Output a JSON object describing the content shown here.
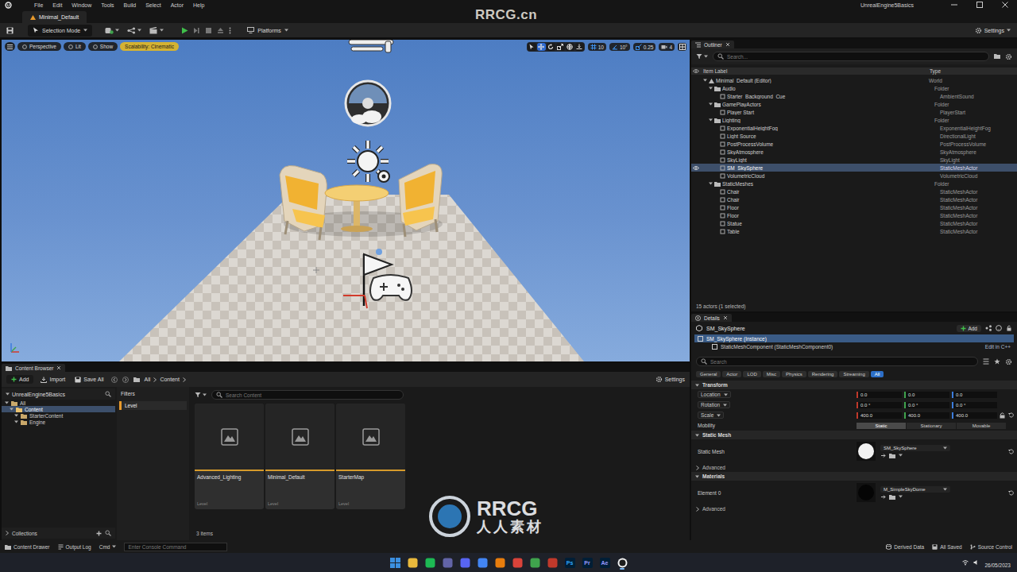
{
  "menu_bar": {
    "items": [
      "File",
      "Edit",
      "Window",
      "Tools",
      "Build",
      "Select",
      "Actor",
      "Help"
    ],
    "project": "UnrealEngine5Basics"
  },
  "level_tab": {
    "label": "Minimal_Default",
    "selected": true
  },
  "toolbar": {
    "mode": "Selection Mode",
    "platforms": "Platforms",
    "settings": "Settings"
  },
  "viewport": {
    "buttons": [
      {
        "label": "Perspective",
        "kind": "plain"
      },
      {
        "label": "Lit",
        "kind": "plain"
      },
      {
        "label": "Show",
        "kind": "plain"
      },
      {
        "label": "Scalability: Cinematic",
        "kind": "warning"
      }
    ],
    "transform_tools": [
      {
        "kind": "select",
        "selected": false
      },
      {
        "kind": "move",
        "selected": true
      },
      {
        "kind": "rotate",
        "selected": false
      },
      {
        "kind": "scale",
        "selected": false
      }
    ],
    "snaps": [
      {
        "kind": "grid",
        "value": "10",
        "on": true
      },
      {
        "kind": "rotate",
        "value": "10°",
        "on": true
      },
      {
        "kind": "scale",
        "value": "0.25",
        "on": true
      },
      {
        "kind": "camera",
        "value": "4",
        "on": false
      }
    ]
  },
  "outliner": {
    "tab": "Outliner",
    "search": "Search...",
    "columns": [
      "Item Label",
      "Type"
    ],
    "rows": [
      {
        "label": "Minimal_Default (Editor)",
        "type": "World",
        "depth": 0,
        "kind": "world",
        "expanded": true,
        "selected": false,
        "eye": false
      },
      {
        "label": "Audio",
        "type": "Folder",
        "depth": 1,
        "kind": "folder",
        "expanded": true,
        "selected": false,
        "eye": false
      },
      {
        "label": "Starter_Background_Cue",
        "type": "AmbientSound",
        "depth": 2,
        "kind": "actor",
        "expanded": false,
        "selected": false,
        "eye": false
      },
      {
        "label": "GamePlayActors",
        "type": "Folder",
        "depth": 1,
        "kind": "folder",
        "expanded": true,
        "selected": false,
        "eye": false
      },
      {
        "label": "Player Start",
        "type": "PlayerStart",
        "depth": 2,
        "kind": "actor",
        "expanded": false,
        "selected": false,
        "eye": false
      },
      {
        "label": "Lighting",
        "type": "Folder",
        "depth": 1,
        "kind": "folder",
        "expanded": true,
        "selected": false,
        "eye": false
      },
      {
        "label": "ExponentialHeightFog",
        "type": "ExponentialHeightFog",
        "depth": 2,
        "kind": "actor",
        "expanded": false,
        "selected": false,
        "eye": false
      },
      {
        "label": "Light Source",
        "type": "DirectionalLight",
        "depth": 2,
        "kind": "actor",
        "expanded": false,
        "selected": false,
        "eye": false
      },
      {
        "label": "PostProcessVolume",
        "type": "PostProcessVolume",
        "depth": 2,
        "kind": "actor",
        "expanded": false,
        "selected": false,
        "eye": false
      },
      {
        "label": "SkyAtmosphere",
        "type": "SkyAtmosphere",
        "depth": 2,
        "kind": "actor",
        "expanded": false,
        "selected": false,
        "eye": false
      },
      {
        "label": "SkyLight",
        "type": "SkyLight",
        "depth": 2,
        "kind": "actor",
        "expanded": false,
        "selected": false,
        "eye": false
      },
      {
        "label": "SM_SkySphere",
        "type": "StaticMeshActor",
        "depth": 2,
        "kind": "actor",
        "expanded": false,
        "selected": true,
        "eye": true
      },
      {
        "label": "VolumetricCloud",
        "type": "VolumetricCloud",
        "depth": 2,
        "kind": "actor",
        "expanded": false,
        "selected": false,
        "eye": false
      },
      {
        "label": "StaticMeshes",
        "type": "Folder",
        "depth": 1,
        "kind": "folder",
        "expanded": true,
        "selected": false,
        "eye": false
      },
      {
        "label": "Chair",
        "type": "StaticMeshActor",
        "depth": 2,
        "kind": "actor",
        "expanded": false,
        "selected": false,
        "eye": false
      },
      {
        "label": "Chair",
        "type": "StaticMeshActor",
        "depth": 2,
        "kind": "actor",
        "expanded": false,
        "selected": false,
        "eye": false
      },
      {
        "label": "Floor",
        "type": "StaticMeshActor",
        "depth": 2,
        "kind": "actor",
        "expanded": false,
        "selected": false,
        "eye": false
      },
      {
        "label": "Floor",
        "type": "StaticMeshActor",
        "depth": 2,
        "kind": "actor",
        "expanded": false,
        "selected": false,
        "eye": false
      },
      {
        "label": "Statue",
        "type": "StaticMeshActor",
        "depth": 2,
        "kind": "actor",
        "expanded": false,
        "selected": false,
        "eye": false
      },
      {
        "label": "Table",
        "type": "StaticMeshActor",
        "depth": 2,
        "kind": "actor",
        "expanded": false,
        "selected": false,
        "eye": false
      }
    ],
    "footer": "15 actors (1 selected)"
  },
  "details": {
    "tab": "Details",
    "title": "SM_SkySphere",
    "add": "Add",
    "components": [
      {
        "label": "SM_SkySphere (Instance)",
        "depth": 0,
        "selected": true,
        "link": ""
      },
      {
        "label": "StaticMeshComponent (StaticMeshComponent0)",
        "depth": 1,
        "selected": false,
        "link": "Edit in C++"
      }
    ],
    "search": "Search",
    "filters": [
      {
        "label": "General",
        "selected": false
      },
      {
        "label": "Actor",
        "selected": false
      },
      {
        "label": "LOD",
        "selected": false
      },
      {
        "label": "Misc",
        "selected": false
      },
      {
        "label": "Physics",
        "selected": false
      },
      {
        "label": "Rendering",
        "selected": false
      },
      {
        "label": "Streaming",
        "selected": false
      },
      {
        "label": "All",
        "selected": true
      }
    ],
    "sections": [
      {
        "title": "Transform",
        "rows": [
          {
            "kind": "vector",
            "label": "Location",
            "values": [
              "0.0",
              "0.0",
              "0.0"
            ],
            "lock_icon": false,
            "resettable": false
          },
          {
            "kind": "vector",
            "label": "Rotation",
            "values": [
              "0.0 °",
              "0.0 °",
              "0.0 °"
            ],
            "lock_icon": false,
            "resettable": false
          },
          {
            "kind": "vector",
            "label": "Scale",
            "values": [
              "400.0",
              "400.0",
              "400.0"
            ],
            "lock_icon": true,
            "resettable": true
          },
          {
            "kind": "mobility",
            "label": "Mobility",
            "options": [
              {
                "label": "Static",
                "selected": true
              },
              {
                "label": "Stationary",
                "selected": false
              },
              {
                "label": "Movable",
                "selected": false
              }
            ]
          }
        ]
      },
      {
        "title": "Static Mesh",
        "rows": [
          {
            "kind": "asset",
            "label": "Static Mesh",
            "asset": "SM_SkySphere",
            "thumb_color": "#f2f2f2",
            "resettable": true
          },
          {
            "kind": "advanced",
            "label": "Advanced"
          }
        ]
      },
      {
        "title": "Materials",
        "rows": [
          {
            "kind": "asset",
            "label": "Element 0",
            "asset": "M_SimpleSkyDome",
            "thumb_color": "#050505",
            "resettable": true
          },
          {
            "kind": "advanced",
            "label": "Advanced"
          }
        ]
      }
    ]
  },
  "content_browser": {
    "tab": "Content Browser",
    "add": "Add",
    "import": "Import",
    "save_all": "Save All",
    "path": [
      "All",
      "Content"
    ],
    "settings": "Settings",
    "project": "UnrealEngine5Basics",
    "tree": [
      {
        "label": "All",
        "depth": 0,
        "selected": false
      },
      {
        "label": "Content",
        "depth": 1,
        "selected": true
      },
      {
        "label": "StarterContent",
        "depth": 2,
        "selected": false
      },
      {
        "label": "Engine",
        "depth": 2,
        "selected": false
      }
    ],
    "filters_title": "Filters",
    "filters": [
      {
        "label": "Level",
        "selected": true
      }
    ],
    "search": "Search Content",
    "assets": [
      {
        "name": "Advanced_Lighting",
        "type": "Level"
      },
      {
        "name": "Minimal_Default",
        "type": "Level"
      },
      {
        "name": "StarterMap",
        "type": "Level"
      }
    ],
    "count": "3 items",
    "collections": "Collections"
  },
  "status_bar": {
    "left": [
      "Content Drawer",
      "Output Log"
    ],
    "cmd": "Cmd",
    "console_placeholder": "Enter Console Command",
    "right": [
      "Derived Data",
      "All Saved",
      "Source Control"
    ]
  },
  "taskbar": {
    "apps": [
      {
        "kind": "windows",
        "color": "#3b8fe0",
        "active": false
      },
      {
        "kind": "app",
        "color": "#e9b93c",
        "active": false
      },
      {
        "kind": "app",
        "color": "#1db954",
        "active": false
      },
      {
        "kind": "app",
        "color": "#6264a7",
        "active": false
      },
      {
        "kind": "app",
        "color": "#5865f2",
        "active": false
      },
      {
        "kind": "app",
        "color": "#4285f4",
        "active": false
      },
      {
        "kind": "app",
        "color": "#e87d0d",
        "active": false
      },
      {
        "kind": "app",
        "color": "#d9433a",
        "active": false
      },
      {
        "kind": "app",
        "color": "#3fa34d",
        "active": false
      },
      {
        "kind": "app",
        "color": "#c0392b",
        "active": false
      },
      {
        "kind": "app",
        "label": "Ps",
        "color": "#31a8ff",
        "active": false
      },
      {
        "kind": "app",
        "label": "Pr",
        "color": "#9999ff",
        "active": false
      },
      {
        "kind": "app",
        "label": "Ae",
        "color": "#9999ff",
        "active": false
      },
      {
        "kind": "unreal",
        "color": "#f4f4f4",
        "active": true
      }
    ],
    "date": "26/05/2023"
  },
  "watermarks": {
    "top": "RRCG.cn",
    "logo": "RRCG",
    "logo_sub": "人人素材"
  }
}
